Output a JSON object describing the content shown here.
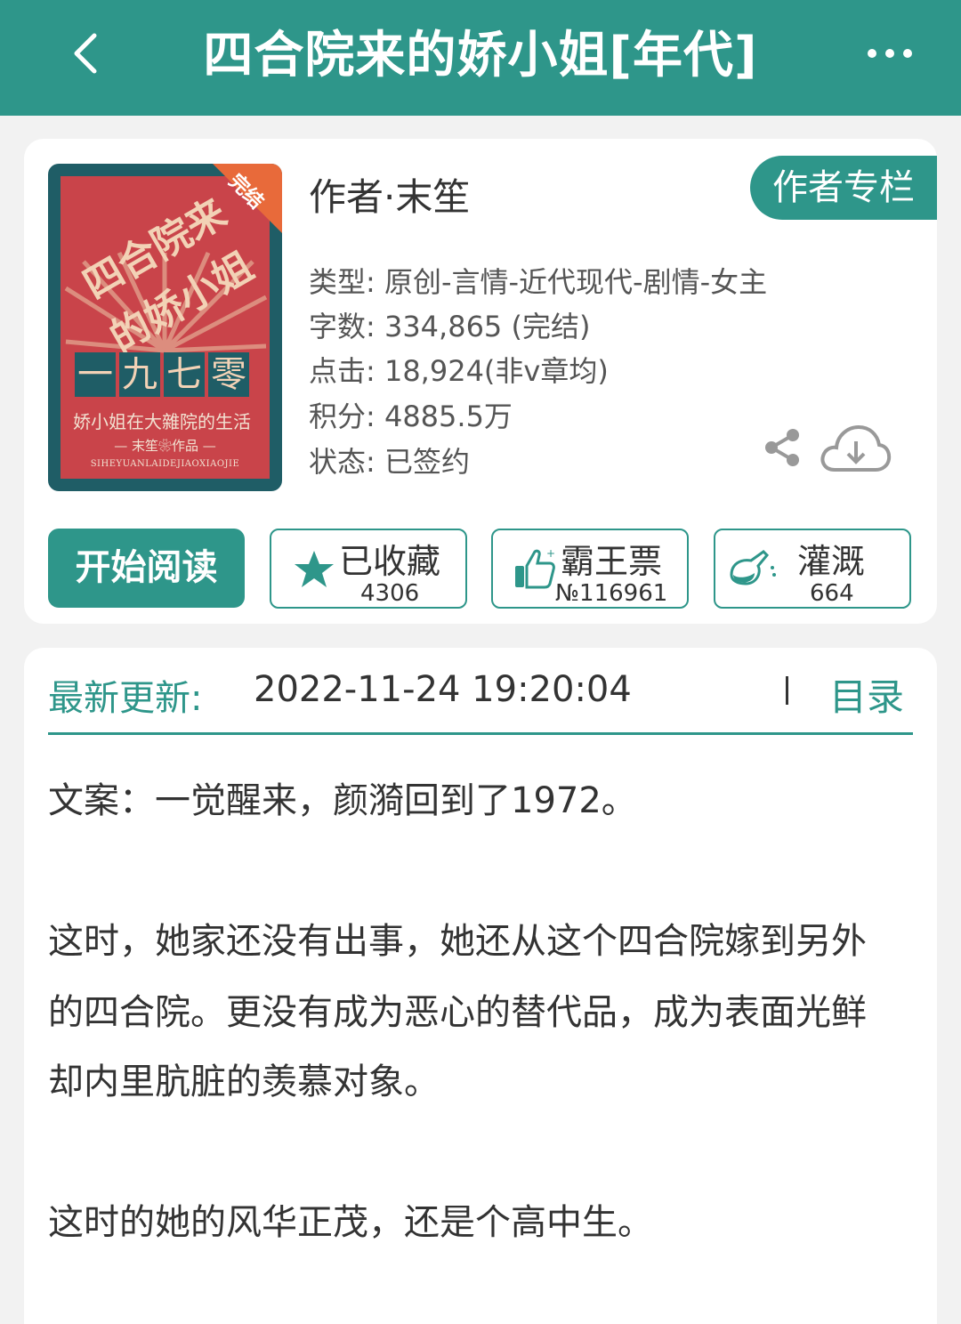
{
  "header": {
    "title": "四合院来的娇小姐[年代]"
  },
  "book": {
    "cover": {
      "badge": "完结",
      "title_line1": "四合院来",
      "title_line2": "的娇小姐",
      "year": [
        "一",
        "九",
        "七",
        "零"
      ],
      "subtitle": "娇小姐在大雜院的生活",
      "author_line": "— 末笙❀作品 —",
      "pinyin": "SIHEYUANLAIDEJIAOXIAOJIE"
    },
    "author": "作者·末笙",
    "author_column": "作者专栏",
    "meta": [
      "类型: 原创-言情-近代现代-剧情-女主",
      "字数: 334,865 (完结)",
      "点击: 18,924(非v章均)",
      "积分: 4885.5万",
      "状态: 已签约"
    ]
  },
  "actions": {
    "read": "开始阅读",
    "collect": {
      "label": "已收藏",
      "count": "4306"
    },
    "vote": {
      "label": "霸王票",
      "count": "№116961"
    },
    "water": {
      "label": "灌溉",
      "count": "664"
    }
  },
  "update": {
    "label": "最新更新:",
    "time": "2022-11-24 19:20:04",
    "toc": "目录"
  },
  "synopsis": [
    "文案：一觉醒来，颜漪回到了1972。",
    "这时，她家还没有出事，她还从这个四合院嫁到另外",
    "的四合院。更没有成为恶心的替代品，成为表面光鲜",
    "却内里肮脏的羡慕对象。",
    "这时的她的风华正茂，还是个高中生。"
  ],
  "colors": {
    "accent": "#2e968a",
    "cover_red": "#c9444a",
    "cover_border": "#1f5d66"
  }
}
